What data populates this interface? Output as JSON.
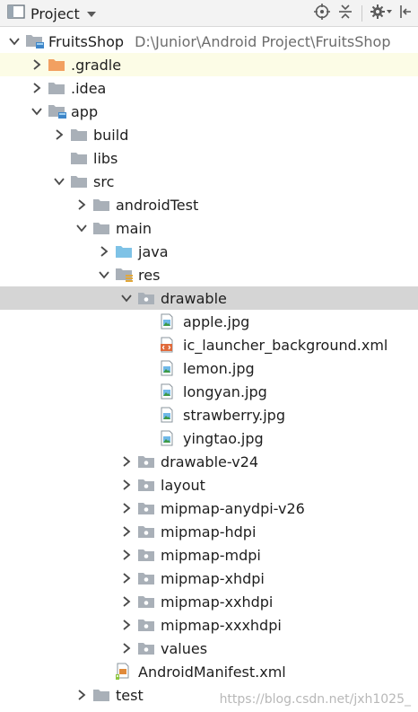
{
  "toolbar": {
    "title": "Project",
    "icons": [
      "project-view-icon",
      "dropdown-icon",
      "locate-icon",
      "collapse-all-icon",
      "gear-icon",
      "hide-icon"
    ]
  },
  "tree": [
    {
      "label": "FruitsShop",
      "path": "D:\\Junior\\Android Project\\FruitsShop",
      "depth": 0,
      "expander": "open",
      "icon": "module-folder-icon"
    },
    {
      "label": ".gradle",
      "depth": 1,
      "expander": "closed",
      "icon": "excluded-folder-icon",
      "state": "highlight"
    },
    {
      "label": ".idea",
      "depth": 1,
      "expander": "closed",
      "icon": "folder-icon"
    },
    {
      "label": "app",
      "depth": 1,
      "expander": "open",
      "icon": "module-folder-icon"
    },
    {
      "label": "build",
      "depth": 2,
      "expander": "closed",
      "icon": "folder-icon"
    },
    {
      "label": "libs",
      "depth": 2,
      "expander": "none",
      "icon": "folder-icon"
    },
    {
      "label": "src",
      "depth": 2,
      "expander": "open",
      "icon": "folder-icon"
    },
    {
      "label": "androidTest",
      "depth": 3,
      "expander": "closed",
      "icon": "folder-icon"
    },
    {
      "label": "main",
      "depth": 3,
      "expander": "open",
      "icon": "folder-icon"
    },
    {
      "label": "java",
      "depth": 4,
      "expander": "closed",
      "icon": "source-folder-icon"
    },
    {
      "label": "res",
      "depth": 4,
      "expander": "open",
      "icon": "resources-folder-icon"
    },
    {
      "label": "drawable",
      "depth": 5,
      "expander": "open",
      "icon": "package-folder-icon",
      "state": "selected"
    },
    {
      "label": "apple.jpg",
      "depth": 6,
      "expander": "none",
      "icon": "image-file-icon"
    },
    {
      "label": "ic_launcher_background.xml",
      "depth": 6,
      "expander": "none",
      "icon": "xml-file-icon"
    },
    {
      "label": "lemon.jpg",
      "depth": 6,
      "expander": "none",
      "icon": "image-file-icon"
    },
    {
      "label": "longyan.jpg",
      "depth": 6,
      "expander": "none",
      "icon": "image-file-icon"
    },
    {
      "label": "strawberry.jpg",
      "depth": 6,
      "expander": "none",
      "icon": "image-file-icon"
    },
    {
      "label": "yingtao.jpg",
      "depth": 6,
      "expander": "none",
      "icon": "image-file-icon"
    },
    {
      "label": "drawable-v24",
      "depth": 5,
      "expander": "closed",
      "icon": "package-folder-icon"
    },
    {
      "label": "layout",
      "depth": 5,
      "expander": "closed",
      "icon": "package-folder-icon"
    },
    {
      "label": "mipmap-anydpi-v26",
      "depth": 5,
      "expander": "closed",
      "icon": "package-folder-icon"
    },
    {
      "label": "mipmap-hdpi",
      "depth": 5,
      "expander": "closed",
      "icon": "package-folder-icon"
    },
    {
      "label": "mipmap-mdpi",
      "depth": 5,
      "expander": "closed",
      "icon": "package-folder-icon"
    },
    {
      "label": "mipmap-xhdpi",
      "depth": 5,
      "expander": "closed",
      "icon": "package-folder-icon"
    },
    {
      "label": "mipmap-xxhdpi",
      "depth": 5,
      "expander": "closed",
      "icon": "package-folder-icon"
    },
    {
      "label": "mipmap-xxxhdpi",
      "depth": 5,
      "expander": "closed",
      "icon": "package-folder-icon"
    },
    {
      "label": "values",
      "depth": 5,
      "expander": "closed",
      "icon": "package-folder-icon"
    },
    {
      "label": "AndroidManifest.xml",
      "depth": 4,
      "expander": "none",
      "icon": "manifest-file-icon"
    },
    {
      "label": "test",
      "depth": 3,
      "expander": "closed",
      "icon": "folder-icon"
    }
  ],
  "watermark": "https://blog.csdn.net/jxh1025_",
  "colors": {
    "folder": "#a9b0b8",
    "excluded_folder": "#f2a061",
    "source_folder": "#7ec2e6",
    "selection": "#d5d5d5",
    "highlight": "#fcfce6"
  }
}
